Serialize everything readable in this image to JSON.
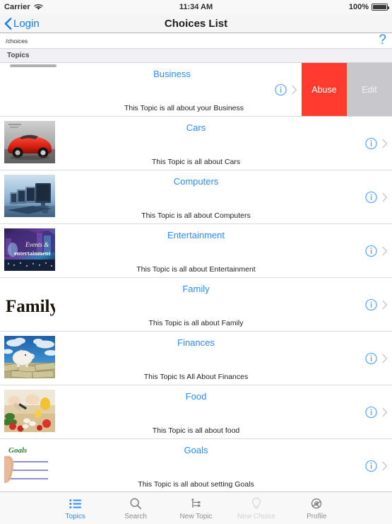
{
  "status_bar": {
    "carrier": "Carrier",
    "wifi_icon": "wifi-icon",
    "time": "11:34 AM",
    "battery_percent": "100%",
    "battery_icon": "battery-full-icon"
  },
  "nav_bar": {
    "back_icon": "chevron-left-icon",
    "back_label": "Login",
    "title": "Choices List"
  },
  "path_bar": {
    "path": "/choices",
    "help_label": "?"
  },
  "section": {
    "header": "Topics"
  },
  "colors": {
    "accent_blue": "#2f8bff",
    "destructive_red": "#ff3b30",
    "edit_gray": "#c7c7cc",
    "section_bg": "#efeff4",
    "nav_bg": "#f5f5f5"
  },
  "swipe_actions": {
    "abuse_label": "Abuse",
    "edit_label": "Edit"
  },
  "list": {
    "info_icon": "info-circle-icon",
    "disclosure_icon": "chevron-right-icon",
    "rows": [
      {
        "title": "Business",
        "subtitle": "This Topic is all about your Business",
        "thumb": "no-thumbnail",
        "swiped": true
      },
      {
        "title": "Cars",
        "subtitle": "This Topic is all about Cars",
        "thumb": "red-sports-car-photo",
        "swiped": false
      },
      {
        "title": "Computers",
        "subtitle": "This Topic is all about Computers",
        "thumb": "desktop-computers-photo",
        "swiped": false
      },
      {
        "title": "Entertainment",
        "subtitle": "This Topic is all about Entertainment",
        "thumb": "events-and-entertainment-marquee-photo",
        "swiped": false
      },
      {
        "title": "Family",
        "subtitle": "This Topic is all about Family",
        "thumb": "family-wordmark-image",
        "swiped": false
      },
      {
        "title": "Finances",
        "subtitle": "This Topic Is All About Finances",
        "thumb": "piggy-bank-on-money-photo",
        "swiped": false
      },
      {
        "title": "Food",
        "subtitle": "This Topic is all about food",
        "thumb": "chopping-vegetables-photo",
        "swiped": false
      },
      {
        "title": "Goals",
        "subtitle": "This Topic is all about setting Goals",
        "thumb": "goals-checklist-image",
        "swiped": false
      }
    ]
  },
  "tab_bar": {
    "tabs": [
      {
        "label": "Topics",
        "icon": "bulleted-list-icon",
        "state": "active"
      },
      {
        "label": "Search",
        "icon": "magnifier-icon",
        "state": "normal"
      },
      {
        "label": "New Topic",
        "icon": "hierarchy-node-icon",
        "state": "normal"
      },
      {
        "label": "New Choice",
        "icon": "lightbulb-icon",
        "state": "disabled"
      },
      {
        "label": "Profile",
        "icon": "gear-icon",
        "state": "normal"
      }
    ]
  }
}
